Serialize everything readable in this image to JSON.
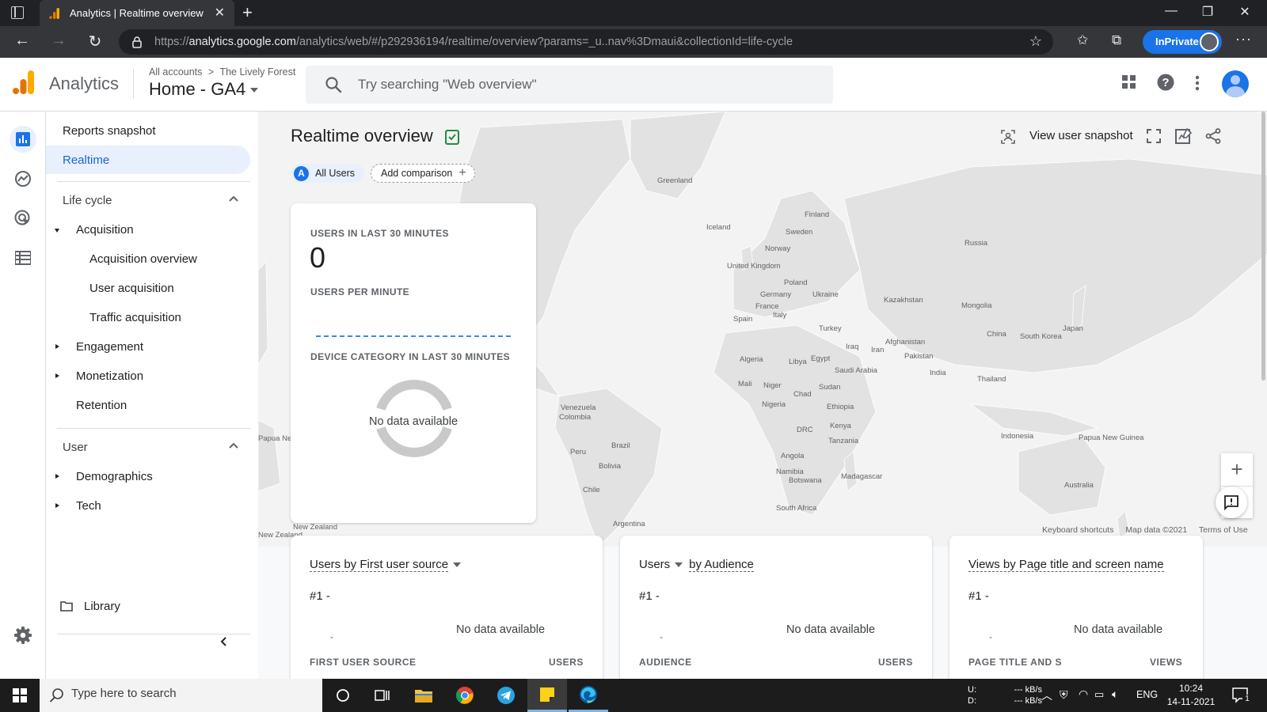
{
  "browser": {
    "tab_title": "Analytics | Realtime overview",
    "url_prefix": "https://",
    "url_host": "analytics.google.com",
    "url_path": "/analytics/web/#/p292936194/realtime/overview?params=_u..nav%3Dmaui&collectionId=life-cycle",
    "inprivate_label": "InPrivate"
  },
  "header": {
    "product_name": "Analytics",
    "breadcrumb_root": "All accounts",
    "breadcrumb_sep": ">",
    "breadcrumb_account": "The Lively Forest",
    "property_name": "Home - GA4",
    "search_placeholder": "Try searching \"Web overview\""
  },
  "nav": {
    "reports_snapshot": "Reports snapshot",
    "realtime": "Realtime",
    "life_cycle": "Life cycle",
    "acquisition": "Acquisition",
    "acquisition_overview": "Acquisition overview",
    "user_acquisition": "User acquisition",
    "traffic_acquisition": "Traffic acquisition",
    "engagement": "Engagement",
    "monetization": "Monetization",
    "retention": "Retention",
    "user": "User",
    "demographics": "Demographics",
    "tech": "Tech",
    "library": "Library"
  },
  "main": {
    "title": "Realtime overview",
    "all_users_letter": "A",
    "all_users": "All Users",
    "add_comparison": "Add comparison",
    "view_user_snapshot": "View user snapshot"
  },
  "realtime_card": {
    "users_caption": "USERS IN LAST 30 MINUTES",
    "users_value": "0",
    "per_minute_caption": "USERS PER MINUTE",
    "device_caption": "DEVICE CATEGORY IN LAST 30 MINUTES",
    "no_data": "No data available"
  },
  "map": {
    "labels": [
      "Greenland",
      "Iceland",
      "Finland",
      "Sweden",
      "Norway",
      "Russia",
      "United Kingdom",
      "Poland",
      "Germany",
      "Ukraine",
      "France",
      "Spain",
      "Italy",
      "Kazakhstan",
      "Mongolia",
      "Turkey",
      "China",
      "Japan",
      "South Korea",
      "Afghanistan",
      "Iraq",
      "Iran",
      "Pakistan",
      "India",
      "Algeria",
      "Libya",
      "Egypt",
      "Saudi Arabia",
      "Thailand",
      "Mali",
      "Niger",
      "Chad",
      "Sudan",
      "Nigeria",
      "Ethiopia",
      "Kenya",
      "DRC",
      "Tanzania",
      "Venezuela",
      "Colombia",
      "Brazil",
      "Peru",
      "Bolivia",
      "Chile",
      "Argentina",
      "Angola",
      "Namibia",
      "Botswana",
      "Madagascar",
      "South Africa",
      "Indonesia",
      "Papua New Guinea",
      "Australia",
      "New Zealand",
      "Papua New Guinea",
      "New Zealand"
    ],
    "footer_shortcuts": "Keyboard shortcuts",
    "footer_data": "Map data ©2021",
    "footer_terms": "Terms of Use"
  },
  "bottom_cards": [
    {
      "title_a": "Users by First user source",
      "title_b": "",
      "rank": "#1  -",
      "dash": "-",
      "no_data": "No data available",
      "col_left": "FIRST USER SOURCE",
      "col_right": "USERS"
    },
    {
      "title_a": "Users",
      "title_b": "by Audience",
      "rank": "#1  -",
      "dash": "-",
      "no_data": "No data available",
      "col_left": "AUDIENCE",
      "col_right": "USERS"
    },
    {
      "title_a": "Views by Page title and screen name",
      "title_b": "",
      "rank": "#1  -",
      "dash": "-",
      "no_data": "No data available",
      "col_left": "PAGE TITLE AND S",
      "col_right": "VIEWS"
    }
  ],
  "taskbar": {
    "search_placeholder": "Type here to search",
    "net_up_label": "U:",
    "net_down_label": "D:",
    "net_up": "--- kB/s",
    "net_down": "--- kB/s",
    "language": "ENG",
    "time": "10:24",
    "date": "14-11-2021",
    "notification_count": "1"
  },
  "colors": {
    "ga_orange": "#f9ab00",
    "ga_orange_dark": "#e37400",
    "accent_blue": "#1a73e8",
    "nav_active_bg": "#e8f0fe",
    "check_green": "#1e8e3e"
  }
}
